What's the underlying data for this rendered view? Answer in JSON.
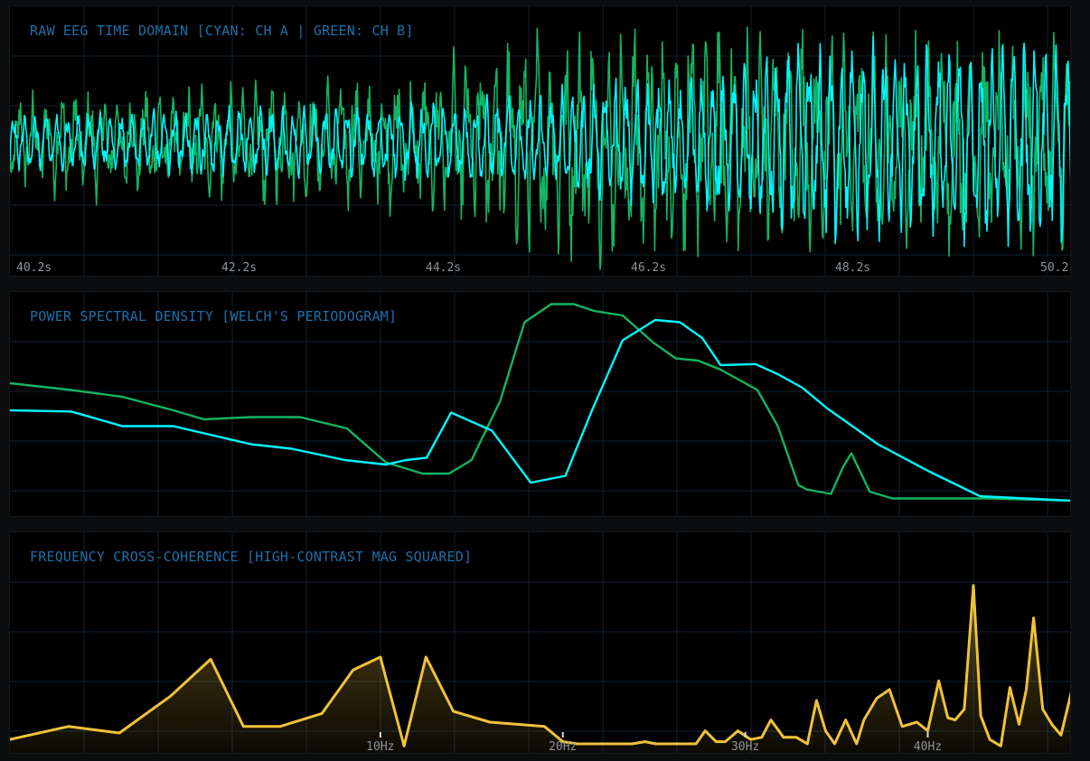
{
  "panels": {
    "time": {
      "title": "RAW EEG TIME DOMAIN [CYAN: CH A | GREEN: CH B]"
    },
    "psd": {
      "title": "POWER SPECTRAL DENSITY [WELCH'S PERIODOGRAM]"
    },
    "coh": {
      "title": "FREQUENCY CROSS-COHERENCE [HIGH-CONTRAST MAG SQUARED]"
    }
  },
  "colors": {
    "ch_a": "#00f6ff",
    "ch_b": "#12b463",
    "coherence": "#f0c23a",
    "grid": "#0f2230",
    "tick": "#8c949a",
    "title": "#1f6fa8"
  },
  "chart_data": [
    {
      "type": "line",
      "title": "RAW EEG TIME DOMAIN [CYAN: CH A | GREEN: CH B]",
      "x_ticks": [
        "40.2s",
        "42.2s",
        "44.2s",
        "46.2s",
        "48.2s",
        "50.2"
      ],
      "xlim": [
        40.2,
        50.6
      ],
      "ylim": [
        -1,
        1
      ],
      "grid": true,
      "series": [
        {
          "name": "CH A",
          "color": "#00f6ff",
          "envelope": {
            "x": [
              40.2,
              42.2,
              44.2,
              45.2,
              46.2,
              47.2,
              47.9,
              48.2,
              50.2,
              50.6
            ],
            "amplitude": [
              0.22,
              0.28,
              0.32,
              0.38,
              0.52,
              0.6,
              0.82,
              0.82,
              0.85,
              0.85
            ]
          }
        },
        {
          "name": "CH B",
          "color": "#12b463",
          "envelope": {
            "x": [
              40.2,
              42.2,
              44.2,
              45.0,
              46.2,
              47.2,
              48.2,
              50.2,
              50.6
            ],
            "amplitude": [
              0.4,
              0.45,
              0.52,
              0.8,
              0.9,
              0.92,
              0.85,
              0.85,
              0.85
            ]
          }
        }
      ]
    },
    {
      "type": "line",
      "title": "POWER SPECTRAL DENSITY [WELCH'S PERIODOGRAM]",
      "xlim": [
        0,
        52
      ],
      "ylim": [
        0,
        1
      ],
      "grid": true,
      "series": [
        {
          "name": "CH A",
          "color": "#00f6ff",
          "x": [
            0,
            3,
            5.5,
            8,
            11.8,
            13.8,
            16.4,
            18.4,
            19.4,
            20.4,
            21.6,
            23.6,
            25.5,
            27.2,
            28.5,
            30,
            31.6,
            32.8,
            33.9,
            34.8,
            36.5,
            37.6,
            38.8,
            40,
            42.5,
            45,
            47.5,
            52
          ],
          "y": [
            0.46,
            0.455,
            0.39,
            0.39,
            0.31,
            0.29,
            0.24,
            0.22,
            0.24,
            0.25,
            0.45,
            0.37,
            0.14,
            0.17,
            0.46,
            0.77,
            0.86,
            0.85,
            0.78,
            0.66,
            0.665,
            0.62,
            0.56,
            0.47,
            0.31,
            0.19,
            0.08,
            0.06
          ]
        },
        {
          "name": "CH B",
          "color": "#12b463",
          "x": [
            0,
            3,
            5.5,
            8,
            9.5,
            11.8,
            14.2,
            16.5,
            18.4,
            20.2,
            21.5,
            22.6,
            24,
            25.2,
            26.5,
            27.6,
            28.6,
            30,
            31.5,
            32.6,
            33.7,
            34.8,
            36.6,
            37.6,
            38.6,
            39,
            40.2,
            40.8,
            41.2,
            42.1,
            43.2,
            44,
            45,
            46,
            47,
            48,
            50,
            52
          ],
          "y": [
            0.58,
            0.55,
            0.52,
            0.46,
            0.42,
            0.43,
            0.43,
            0.38,
            0.23,
            0.18,
            0.18,
            0.24,
            0.5,
            0.85,
            0.93,
            0.93,
            0.9,
            0.88,
            0.76,
            0.69,
            0.68,
            0.64,
            0.55,
            0.39,
            0.13,
            0.11,
            0.09,
            0.21,
            0.27,
            0.1,
            0.07,
            0.07,
            0.07,
            0.07,
            0.07,
            0.07,
            0.065,
            0.06
          ]
        }
      ]
    },
    {
      "type": "area",
      "title": "FREQUENCY CROSS-COHERENCE [HIGH-CONTRAST MAG SQUARED]",
      "x_ticks": [
        "10Hz",
        "20Hz",
        "30Hz",
        "40Hz"
      ],
      "tick_values": [
        10,
        20,
        30,
        40
      ],
      "xlim": [
        -10.3,
        47.9
      ],
      "ylim": [
        0,
        1
      ],
      "grid": true,
      "series": [
        {
          "name": "",
          "color": "#f0c23a",
          "x": [
            -10.3,
            -7.1,
            -4.3,
            -1.5,
            0.7,
            2.5,
            4.5,
            6.8,
            8.5,
            10,
            11.3,
            12.5,
            14,
            16,
            17.5,
            19,
            20,
            20.8,
            21.6,
            22.4,
            23.2,
            23.8,
            24.5,
            25.1,
            25.6,
            26.1,
            26.7,
            27.3,
            27.8,
            28.4,
            28.9,
            29.6,
            30.3,
            30.9,
            31.4,
            32.1,
            32.8,
            33.4,
            33.9,
            34.4,
            34.9,
            35.5,
            36.1,
            36.5,
            37.2,
            37.9,
            38.6,
            39.4,
            40,
            40.6,
            41.1,
            41.5,
            42,
            42.5,
            42.9,
            43.4,
            44,
            44.5,
            45,
            45.4,
            45.8,
            46.3,
            46.8,
            47.3,
            47.9
          ],
          "y": [
            0.07,
            0.13,
            0.1,
            0.27,
            0.44,
            0.13,
            0.13,
            0.19,
            0.39,
            0.45,
            0.04,
            0.45,
            0.2,
            0.15,
            0.14,
            0.13,
            0.06,
            0.05,
            0.05,
            0.05,
            0.05,
            0.05,
            0.06,
            0.05,
            0.05,
            0.05,
            0.05,
            0.05,
            0.11,
            0.06,
            0.06,
            0.11,
            0.07,
            0.08,
            0.16,
            0.08,
            0.08,
            0.05,
            0.25,
            0.11,
            0.05,
            0.16,
            0.05,
            0.16,
            0.26,
            0.3,
            0.13,
            0.15,
            0.11,
            0.34,
            0.17,
            0.16,
            0.21,
            0.78,
            0.18,
            0.07,
            0.04,
            0.31,
            0.14,
            0.3,
            0.63,
            0.21,
            0.14,
            0.09,
            0.3
          ]
        }
      ]
    }
  ]
}
